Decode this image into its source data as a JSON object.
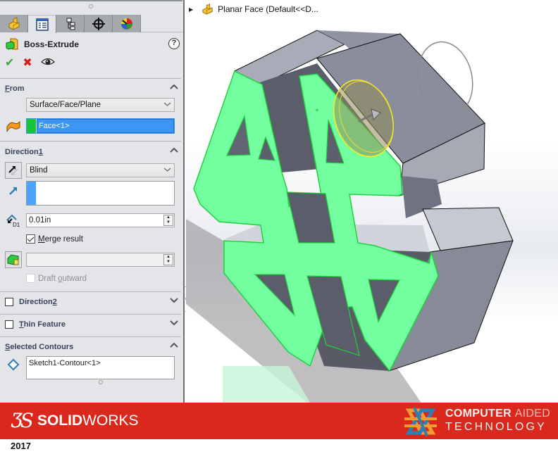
{
  "panel": {
    "tabs": [
      {
        "name": "featuremanager",
        "icon": "part-icon"
      },
      {
        "name": "propertymanager",
        "icon": "property-list-icon",
        "active": true
      },
      {
        "name": "configurationmanager",
        "icon": "config-tree-icon"
      },
      {
        "name": "dimxpertmanager",
        "icon": "crosshair-icon"
      },
      {
        "name": "displaymanager",
        "icon": "color-wheel-icon"
      }
    ],
    "feature_title": "Boss-Extrude",
    "help_label": "?",
    "actions": {
      "ok": "✔",
      "cancel": "✖",
      "preview": "eye"
    },
    "from": {
      "title_first": "F",
      "title_rest": "rom",
      "dropdown_value": "Surface/Face/Plane",
      "selection": "Face<1>",
      "selection_color": "#16c63a"
    },
    "direction1": {
      "title_main": "Direction ",
      "title_num": "1",
      "end_condition": "Blind",
      "direction_color": "#4da3ff",
      "depth": "0.01in",
      "merge_result_label": "Merge result",
      "merge_result_checked": true,
      "draft_value": "",
      "draft_outward_label": "Draft outward",
      "draft_outward_checked": false,
      "draft_outward_enabled": false
    },
    "direction2": {
      "title_main": "Direction ",
      "title_num": "2",
      "checked": false
    },
    "thin_feature": {
      "title_first": "T",
      "title_rest": "hin Feature",
      "checked": false
    },
    "selected_contours": {
      "title_first": "S",
      "title_rest": "elected Contours",
      "items": [
        "Sketch1-Contour<1>"
      ]
    }
  },
  "viewport": {
    "tree_item": "Planar Face  (Default<<D...",
    "highlight_color": "#73ff9f",
    "highlight_edge": "#1fd13f"
  },
  "banner": {
    "brand_bold": "SOLID",
    "brand_light": "WORKS",
    "version": "2017",
    "partner_line1_bold": "COMPUTER ",
    "partner_line1_light": "AIDED",
    "partner_line2": "TECHNOLOGY",
    "color": "#da291c"
  }
}
